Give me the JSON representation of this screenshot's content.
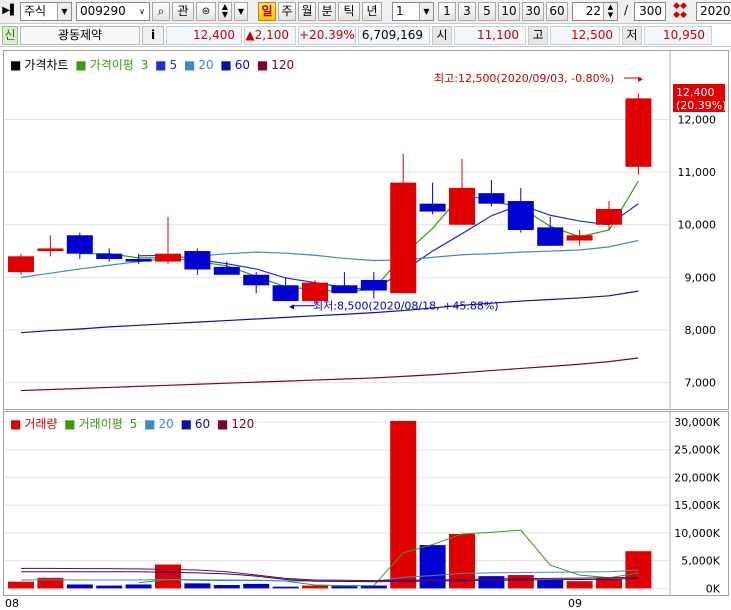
{
  "toolbar": {
    "market_select": "주식",
    "stock_code": "009290",
    "relation_button": "관",
    "period_buttons": [
      "일",
      "주",
      "월",
      "분",
      "틱",
      "년"
    ],
    "active_period": "일",
    "unit_select": "1",
    "quick_units": [
      "1",
      "3",
      "5",
      "10",
      "30",
      "60"
    ],
    "display_count": "22",
    "total_count": "300",
    "date_field": "2020/"
  },
  "info": {
    "badge": "신",
    "stock_name": "광동제약",
    "info_button": "i",
    "current_price": "12,400",
    "change": "▲2,100",
    "change_rate": "+20.39%",
    "volume": "6,709,169",
    "open_label": "시",
    "open_value": "11,100",
    "high_label": "고",
    "high_value": "12,500",
    "low_label": "저",
    "low_value": "10,950"
  },
  "price_legend": {
    "title": "가격차트",
    "ma_title": "가격이평",
    "periods": [
      "3",
      "5",
      "20",
      "60",
      "120"
    ]
  },
  "volume_legend": {
    "title": "거래량",
    "ma_title": "거래이평",
    "periods": [
      "5",
      "20",
      "60",
      "120"
    ]
  },
  "annotations": {
    "high_note": "최고:12,500(2020/09/03, -0.80%)",
    "low_note": "최저:8,500(2020/08/18, +45.88%)",
    "last_price": "12,400",
    "last_rate": "(20.39%)"
  },
  "x_labels": [
    "08",
    "09"
  ],
  "colors": {
    "up": "#e00000",
    "down": "#0000d0",
    "ma3": "#3a9a10",
    "ma5": "#2030c8",
    "ma20": "#3a8ac8",
    "ma60": "#1010a0",
    "ma120": "#800030"
  },
  "chart_data": [
    {
      "type": "candlestick",
      "title": "가격차트",
      "y_ticks": [
        "7,000",
        "8,000",
        "9,000",
        "10,000",
        "11,000",
        "12,000"
      ],
      "ylim": [
        6500,
        13300
      ],
      "candles": [
        {
          "o": 9100,
          "h": 9450,
          "l": 9050,
          "c": 9400
        },
        {
          "o": 9500,
          "h": 9800,
          "l": 9400,
          "c": 9550
        },
        {
          "o": 9800,
          "h": 9850,
          "l": 9350,
          "c": 9450
        },
        {
          "o": 9450,
          "h": 9550,
          "l": 9300,
          "c": 9350
        },
        {
          "o": 9350,
          "h": 9450,
          "l": 9250,
          "c": 9300
        },
        {
          "o": 9300,
          "h": 10150,
          "l": 9250,
          "c": 9450
        },
        {
          "o": 9500,
          "h": 9550,
          "l": 9050,
          "c": 9150
        },
        {
          "o": 9200,
          "h": 9300,
          "l": 9050,
          "c": 9050
        },
        {
          "o": 9050,
          "h": 9100,
          "l": 8700,
          "c": 8850
        },
        {
          "o": 8850,
          "h": 9000,
          "l": 8550,
          "c": 8550
        },
        {
          "o": 8550,
          "h": 8950,
          "l": 8500,
          "c": 8900
        },
        {
          "o": 8850,
          "h": 9100,
          "l": 8750,
          "c": 8700
        },
        {
          "o": 8950,
          "h": 9100,
          "l": 8600,
          "c": 8750
        },
        {
          "o": 8700,
          "h": 11350,
          "l": 8700,
          "c": 10800
        },
        {
          "o": 10400,
          "h": 10800,
          "l": 10200,
          "c": 10250
        },
        {
          "o": 10000,
          "h": 11250,
          "l": 10000,
          "c": 10700
        },
        {
          "o": 10600,
          "h": 10850,
          "l": 10350,
          "c": 10400
        },
        {
          "o": 10450,
          "h": 10700,
          "l": 9850,
          "c": 9900
        },
        {
          "o": 9950,
          "h": 10150,
          "l": 9600,
          "c": 9600
        },
        {
          "o": 9700,
          "h": 9900,
          "l": 9600,
          "c": 9800
        },
        {
          "o": 10000,
          "h": 10450,
          "l": 9900,
          "c": 10300
        },
        {
          "o": 11100,
          "h": 12500,
          "l": 10950,
          "c": 12400
        }
      ],
      "series": [
        {
          "name": "3",
          "values": [
            null,
            null,
            9450,
            9450,
            9370,
            9370,
            9300,
            9220,
            9020,
            8820,
            8770,
            8720,
            8780,
            9420,
            9930,
            10580,
            10450,
            10330,
            9970,
            9770,
            9900,
            10830
          ]
        },
        {
          "name": "5",
          "values": [
            null,
            null,
            null,
            null,
            9410,
            9420,
            9340,
            9260,
            9160,
            8990,
            8900,
            8810,
            8760,
            9120,
            9500,
            9830,
            10170,
            10380,
            10180,
            10070,
            10000,
            10400
          ]
        },
        {
          "name": "20",
          "values": [
            9000,
            9080,
            9160,
            9230,
            9300,
            9360,
            9400,
            9450,
            9480,
            9460,
            9420,
            9360,
            9320,
            9330,
            9380,
            9430,
            9450,
            9480,
            9500,
            9520,
            9580,
            9700
          ]
        },
        {
          "name": "60",
          "values": [
            7950,
            7990,
            8020,
            8060,
            8090,
            8120,
            8150,
            8180,
            8210,
            8240,
            8270,
            8300,
            8330,
            8370,
            8420,
            8470,
            8510,
            8550,
            8580,
            8610,
            8650,
            8740
          ]
        },
        {
          "name": "120",
          "values": [
            6850,
            6870,
            6890,
            6910,
            6930,
            6950,
            6970,
            6990,
            7010,
            7030,
            7050,
            7070,
            7090,
            7120,
            7150,
            7190,
            7230,
            7270,
            7310,
            7350,
            7400,
            7470
          ]
        }
      ],
      "highlights": {
        "high": 12500,
        "low": 8500
      }
    },
    {
      "type": "bar",
      "title": "거래량",
      "y_ticks": [
        "0K",
        "5,000K",
        "10,000K",
        "15,000K",
        "20,000K",
        "25,000K",
        "30,000K"
      ],
      "ylim": [
        -1200,
        31800
      ],
      "values": [
        1200,
        1900,
        700,
        500,
        700,
        4300,
        900,
        600,
        800,
        300,
        500,
        400,
        500,
        30200,
        7800,
        9800,
        2200,
        2400,
        1500,
        1300,
        1800,
        6700
      ],
      "up": [
        true,
        true,
        false,
        false,
        false,
        true,
        false,
        false,
        false,
        false,
        true,
        false,
        false,
        true,
        false,
        true,
        false,
        true,
        false,
        true,
        true,
        true
      ],
      "series": [
        {
          "name": "5",
          "values": [
            null,
            null,
            null,
            null,
            1000,
            1600,
            1450,
            1400,
            1450,
            1300,
            600,
            500,
            500,
            6400,
            7900,
            9800,
            10100,
            10500,
            4200,
            2400,
            1900,
            2800
          ]
        },
        {
          "name": "20",
          "values": [
            1500,
            1550,
            1500,
            1500,
            1500,
            1600,
            1550,
            1500,
            1450,
            1350,
            1300,
            1250,
            1250,
            2000,
            2300,
            2700,
            2800,
            2850,
            2900,
            2950,
            3000,
            3300
          ]
        },
        {
          "name": "60",
          "values": [
            3000,
            3000,
            3000,
            3000,
            3000,
            2900,
            2800,
            2600,
            2200,
            1600,
            1300,
            1250,
            1200,
            1250,
            1300,
            1400,
            1450,
            1500,
            1550,
            1600,
            1650,
            1800
          ]
        },
        {
          "name": "120",
          "values": [
            3600,
            3600,
            3550,
            3550,
            3500,
            3400,
            3300,
            3000,
            2400,
            1800,
            1500,
            1450,
            1400,
            1450,
            1500,
            1600,
            1700,
            1750,
            1800,
            1850,
            1900,
            2000
          ]
        }
      ]
    }
  ]
}
